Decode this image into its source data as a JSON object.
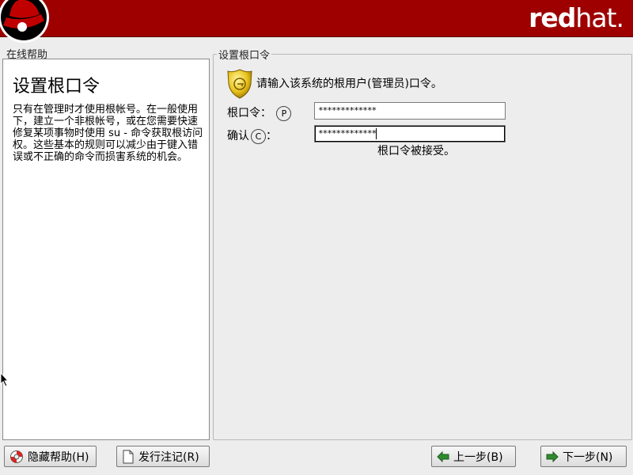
{
  "header": {
    "brand_bold": "red",
    "brand_light": "hat."
  },
  "help": {
    "group_label": "在线帮助",
    "title": "设置根口令",
    "body": "只有在管理时才使用根帐号。在一般使用下，建立一个非根帐号，或在您需要快速修复某项事物时使用 su - 命令获取根访问权。这些基本的规则可以减少由于键入错误或不正确的命令而损害系统的机会。"
  },
  "root_password": {
    "group_label": "设置根口令",
    "prompt": "请输入该系统的根用户(管理员)口令。",
    "password_label": "根口令：",
    "password_mnemonic": "P",
    "password_value": "*************",
    "confirm_label": "确认",
    "confirm_mnemonic": "C",
    "confirm_suffix": "：",
    "confirm_value": "*************",
    "status": "根口令被接受。"
  },
  "buttons": {
    "hide_help": "隐藏帮助(H)",
    "release_notes": "发行注记(R)",
    "back": "上一步(B)",
    "next": "下一步(N)"
  },
  "icons": {
    "logo": "shadowman-hat-logo",
    "prompt": "gold-shield-key-icon",
    "hide_help": "lifebuoy-icon",
    "release_notes": "document-icon",
    "back": "left-arrow-icon",
    "next": "right-arrow-icon"
  },
  "colors": {
    "header_bg": "#9e0000",
    "window_bg": "#ededed"
  }
}
